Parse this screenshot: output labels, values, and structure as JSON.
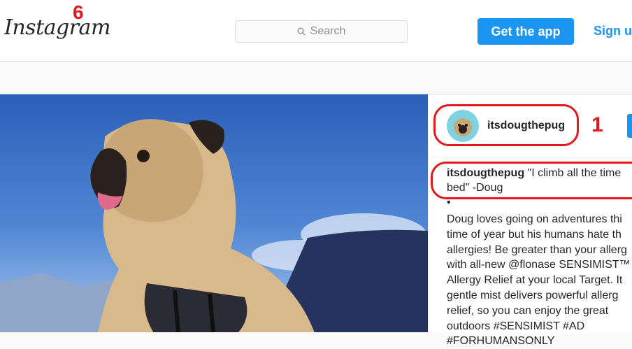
{
  "header": {
    "logo_text": "Instagram",
    "search_placeholder": "Search",
    "get_app_label": "Get the app",
    "signup_label": "Sign u"
  },
  "annotations": {
    "label_6": "6",
    "label_1": "1"
  },
  "post": {
    "username": "itsdougthepug",
    "caption_author": "itsdougthepug",
    "caption_quote": "\"I climb all the time\nbed\" -Doug",
    "bullet": "•",
    "body": "Doug loves going on adventures thi\ntime of year but his humans hate th\nallergies! Be greater than your allerg\nwith all-new @flonase SENSIMIST™\nAllergy Relief at your local Target. It\ngentle mist delivers powerful allerg\nrelief, so you can enjoy the great\noutdoors #SENSIMIST #AD\n#FORHUMANSONLY"
  },
  "colors": {
    "accent": "#1a95f0",
    "annotation": "#e0191b"
  }
}
